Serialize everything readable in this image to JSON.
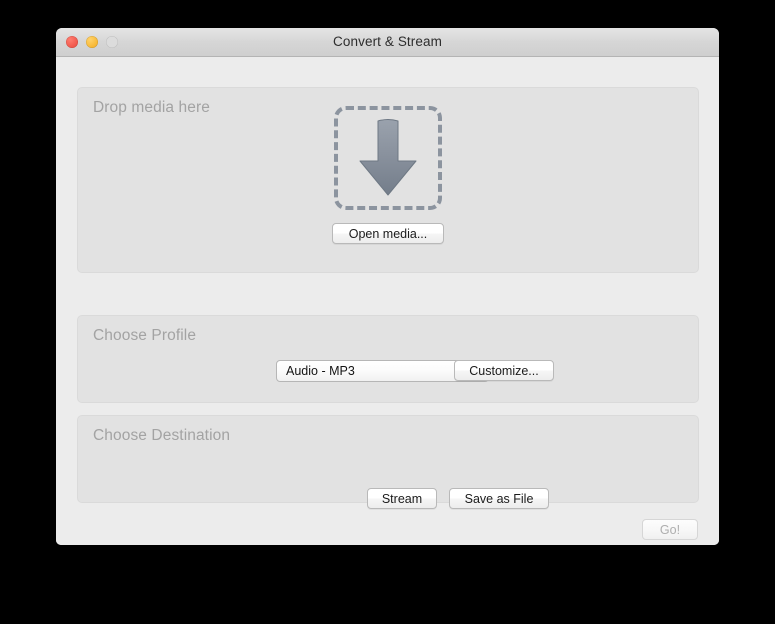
{
  "window": {
    "title": "Convert & Stream",
    "controls": {
      "close": "close-button",
      "minimize": "minimize-button",
      "zoom": "zoom-button"
    }
  },
  "media_panel": {
    "title": "Drop media here",
    "dropzone_icon": "download-arrow-icon",
    "open_media_label": "Open media..."
  },
  "profile_panel": {
    "title": "Choose Profile",
    "selected_profile": "Audio - MP3",
    "stepper_icon": "up-down-chevron-icon",
    "customize_label": "Customize..."
  },
  "destination_panel": {
    "title": "Choose Destination",
    "stream_label": "Stream",
    "save_as_file_label": "Save as File"
  },
  "footer": {
    "go_label": "Go!"
  },
  "colors": {
    "window_background": "#ececec",
    "panel_background": "#e2e2e2",
    "panel_title_text": "#a3a3a3",
    "dropzone_border": "#8c949f",
    "stepper_blue": "#2f87ee",
    "disabled_text": "#aeaeae"
  }
}
